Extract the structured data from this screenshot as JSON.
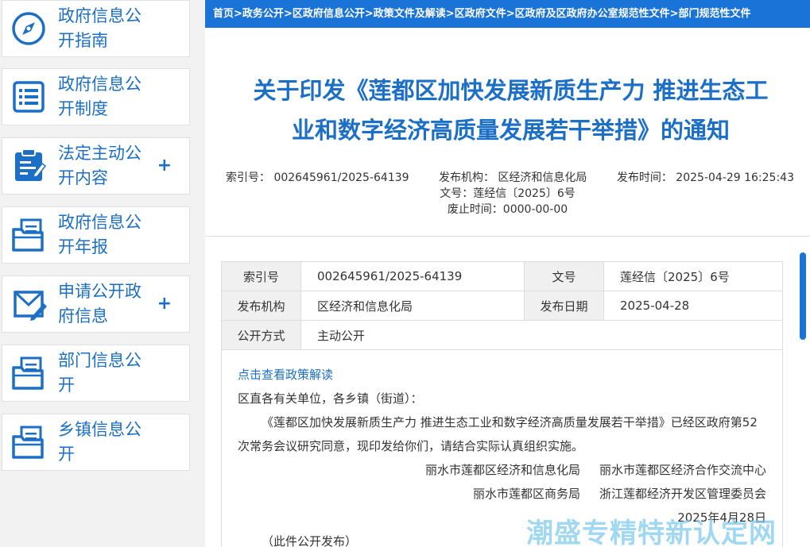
{
  "sidebar": {
    "items": [
      {
        "label": "政府信息公开指南",
        "icon": "compass-icon",
        "expandable": false
      },
      {
        "label": "政府信息公开制度",
        "icon": "list-document-icon",
        "expandable": false
      },
      {
        "label": "法定主动公开内容",
        "icon": "clipboard-icon",
        "expandable": true
      },
      {
        "label": "政府信息公开年报",
        "icon": "folder-document-icon",
        "expandable": false
      },
      {
        "label": "申请公开政府信息",
        "icon": "envelope-pen-icon",
        "expandable": true
      },
      {
        "label": "部门信息公开",
        "icon": "folder-document-icon",
        "expandable": false
      },
      {
        "label": "乡镇信息公开",
        "icon": "folder-document-icon",
        "expandable": false
      }
    ],
    "plus_symbol": "+"
  },
  "breadcrumb": [
    "首页",
    "政务公开",
    "区政府信息公开",
    "政策文件及解读",
    "区政府文件",
    "区政府及区政府办公室规范性文件",
    "部门规范性文件"
  ],
  "breadcrumb_separator": ">",
  "title_line1": "关于印发《莲都区加快发展新质生产力 推进生态工",
  "title_line2": "业和数字经济高质量发展若干举措》的通知",
  "meta": {
    "index_no": "索引号：  002645961/2025-64139",
    "publisher": "发布机构：  区经济和信息化局",
    "publish_time": "发布时间：  2025-04-29 16:25:43",
    "doc_no": "文号：莲经信〔2025〕6号",
    "expiry": "废止时间：0000-00-00"
  },
  "info_table": {
    "index_label": "索引号",
    "index_value": "002645961/2025-64139",
    "docno_label": "文号",
    "docno_value": "莲经信〔2025〕6号",
    "org_label": "发布机构",
    "org_value": "区经济和信息化局",
    "date_label": "发布日期",
    "date_value": "2025-04-28",
    "method_label": "公开方式",
    "method_value": "主动公开"
  },
  "content": {
    "link": "点击查看政策解读",
    "salutation": "区直各有关单位，各乡镇（街道）：",
    "body": "《莲都区加快发展新质生产力 推进生态工业和数字经济高质量发展若干举措》已经区政府第52次常务会议研究同意，现印发给你们，请结合实际认真组织实施。",
    "sig1a": "丽水市莲都区经济和信息化局",
    "sig1b": "丽水市莲都区经济合作交流中心",
    "sig2a": "丽水市莲都区商务局",
    "sig2b": "浙江莲都经济开发区管理委员会",
    "date": "2025年4月28日",
    "note": "（此件公开发布）"
  },
  "watermark": "潮盛专精特新认定网",
  "colors": {
    "accent": "#1a73d6",
    "text_blue": "#1b6fc6"
  }
}
